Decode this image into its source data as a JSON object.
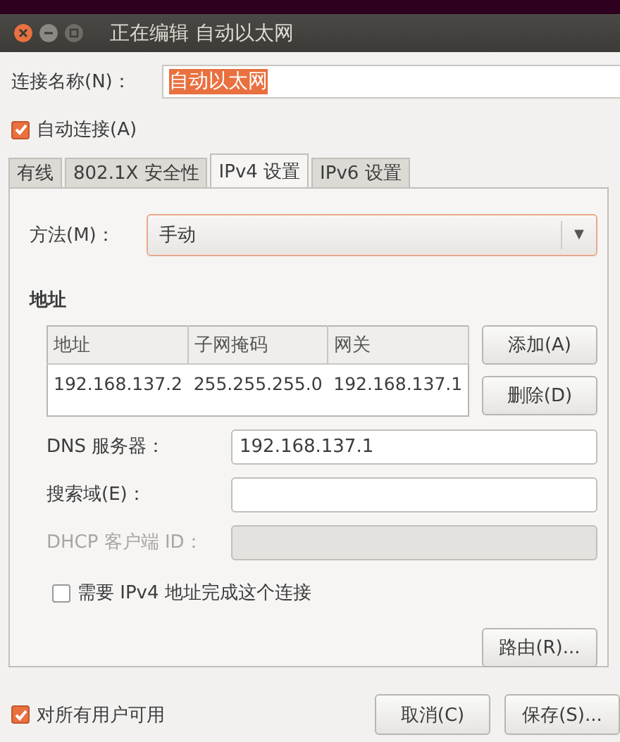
{
  "window": {
    "title": "正在编辑 自动以太网"
  },
  "connection_name": {
    "label": "连接名称(N)：",
    "value": "自动以太网"
  },
  "auto_connect": {
    "label": "自动连接(A)",
    "checked": true
  },
  "tabs": [
    {
      "label": "有线",
      "selected": false
    },
    {
      "label": "802.1X 安全性",
      "selected": false
    },
    {
      "label": "IPv4 设置",
      "selected": true
    },
    {
      "label": "IPv6 设置",
      "selected": false
    }
  ],
  "method": {
    "label": "方法(M)：",
    "value": "手动",
    "arrow": "▼"
  },
  "addresses": {
    "heading": "地址",
    "columns": [
      "地址",
      "子网掩码",
      "网关"
    ],
    "rows": [
      [
        "192.168.137.2",
        "255.255.255.0",
        "192.168.137.1"
      ]
    ],
    "buttons": [
      "添加(A)",
      "删除(D)"
    ]
  },
  "fields": [
    {
      "label": "DNS 服务器：",
      "value": "192.168.137.1",
      "disabled": false
    },
    {
      "label": "搜索域(E)：",
      "disabled": false
    },
    {
      "label": "DHCP 客户端 ID：",
      "disabled": true
    }
  ],
  "require_ipv4": {
    "label": "需要 IPv4 地址完成这个连接",
    "checked": false
  },
  "routes_button": "路由(R)...",
  "all_users": {
    "label": "对所有用户可用",
    "checked": true
  },
  "buttons": [
    "取消(C)",
    "保存(S)..."
  ]
}
